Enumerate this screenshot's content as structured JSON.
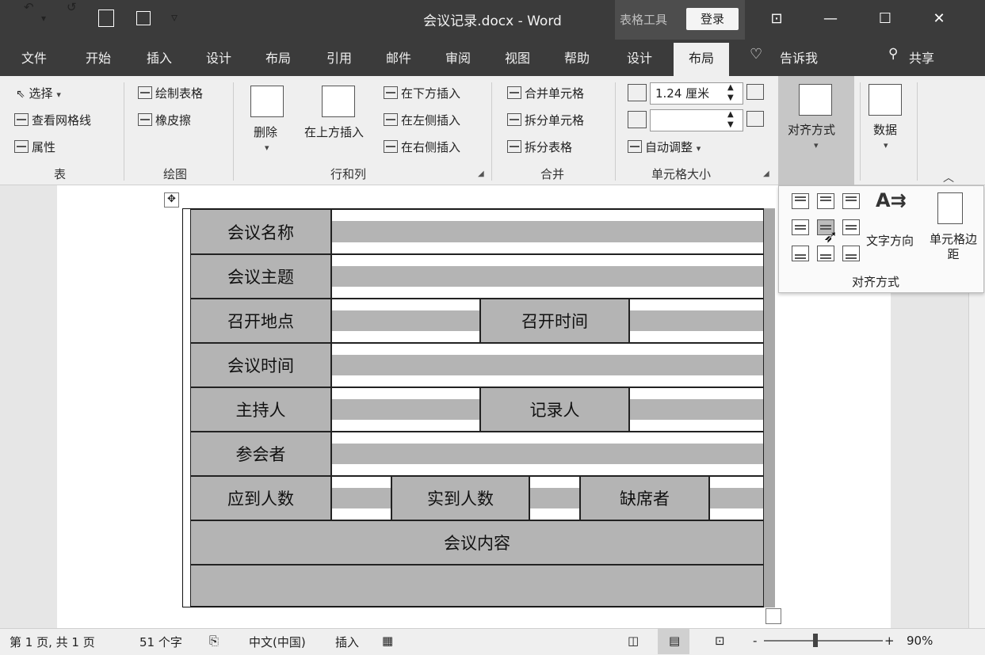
{
  "titlebar": {
    "title": "会议记录.docx  -  Word",
    "table_tools": "表格工具",
    "login": "登录",
    "undo_glyph": "↶",
    "redo_glyph": "↺",
    "save_glyph": "🖫",
    "customize_glyph": "▿",
    "window_buttons": [
      "⊡",
      "—",
      "☐",
      "✕"
    ]
  },
  "tabs": [
    "文件",
    "开始",
    "插入",
    "设计",
    "布局",
    "引用",
    "邮件",
    "审阅",
    "视图",
    "帮助",
    "设计",
    "布局",
    "告诉我",
    "共享"
  ],
  "ribbon": {
    "table_group": {
      "select": "选择",
      "view_gridlines": "查看网格线",
      "properties": "属性",
      "label": "表"
    },
    "draw_group": {
      "draw_table": "绘制表格",
      "eraser": "橡皮擦",
      "label": "绘图"
    },
    "rows_cols_group": {
      "delete": "删除",
      "insert_above": "在上方插入",
      "insert_below": "在下方插入",
      "insert_left": "在左侧插入",
      "insert_right": "在右侧插入",
      "label": "行和列"
    },
    "merge_group": {
      "merge_cells": "合并单元格",
      "split_cells": "拆分单元格",
      "split_table": "拆分表格",
      "label": "合并"
    },
    "cell_size_group": {
      "height_value": "1.24 厘米",
      "width_value": "",
      "autofit": "自动调整",
      "label": "单元格大小"
    },
    "alignment": {
      "label": "对齐方式"
    },
    "data": {
      "label": "数据"
    }
  },
  "align_panel": {
    "text_direction": "文字方向",
    "cell_margins": "单元格边距",
    "label": "对齐方式"
  },
  "table": {
    "rows": [
      [
        "会议名称"
      ],
      [
        "会议主题"
      ],
      [
        "召开地点",
        "召开时间"
      ],
      [
        "会议时间"
      ],
      [
        "主持人",
        "记录人"
      ],
      [
        "参会者"
      ],
      [
        "应到人数",
        "实到人数",
        "缺席者"
      ],
      [
        "会议内容"
      ]
    ]
  },
  "statusbar": {
    "page": "第 1 页, 共 1 页",
    "words": "51 个字",
    "language": "中文(中国)",
    "mode": "插入",
    "zoom": "90%",
    "zoom_minus": "-",
    "zoom_plus": "+"
  },
  "colors": {
    "titlebar": "#3b3b3b",
    "ribbon": "#efefef",
    "cell_gray": "#b4b4b4"
  },
  "icons": [
    "undo-icon",
    "redo-icon",
    "touch-mode-icon",
    "save-icon",
    "lightbulb-icon",
    "user-icon",
    "table-move-icon",
    "cursor-icon"
  ]
}
